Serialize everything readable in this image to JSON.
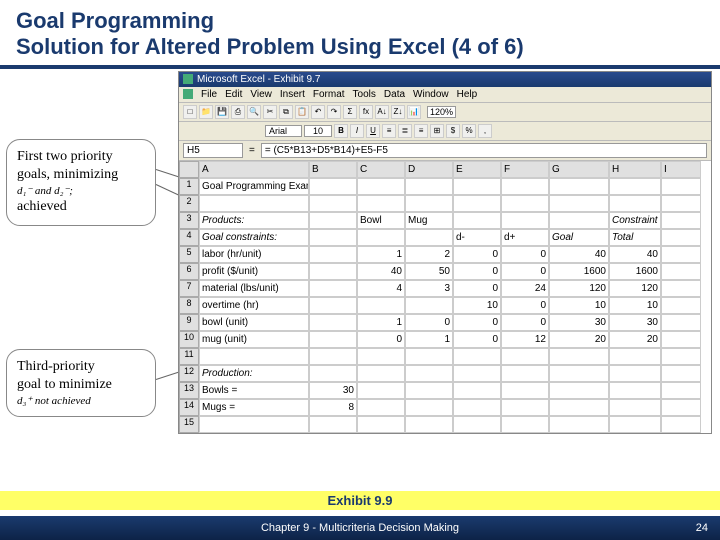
{
  "title_line1": "Goal Programming",
  "title_line2": "Solution for Altered Problem Using Excel (4 of 6)",
  "callout1_l1": "First two priority",
  "callout1_l2": "goals, minimizing",
  "callout1_l3": "d₁⁻ and d₂⁻;",
  "callout1_l4": "achieved",
  "callout2_l1": "Third-priority",
  "callout2_l2": "goal to minimize",
  "callout2_l3": "d₃⁺ not achieved",
  "excel_title": "Microsoft Excel - Exhibit 9.7",
  "menu": {
    "file": "File",
    "edit": "Edit",
    "view": "View",
    "insert": "Insert",
    "format": "Format",
    "tools": "Tools",
    "data": "Data",
    "window": "Window",
    "help": "Help"
  },
  "font": "Arial",
  "fontsize": "10",
  "zoom": "120%",
  "namebox": "H5",
  "formula": "= (C5*B13+D5*B14)+E5-F5",
  "cols": [
    "A",
    "B",
    "C",
    "D",
    "E",
    "F",
    "G",
    "H",
    "I"
  ],
  "rows": {
    "1": {
      "A": "Goal Programming Example: The Beaver Creek Pottery Company"
    },
    "2": {},
    "3": {
      "A": "Products:",
      "C": "Bowl",
      "D": "Mug",
      "H": "Constraint"
    },
    "4": {
      "A": "Goal constraints:",
      "E": "d-",
      "F": "d+",
      "G": "Goal",
      "H": "Total"
    },
    "5": {
      "A": "  labor (hr/unit)",
      "C": "1",
      "D": "2",
      "E": "0",
      "F": "0",
      "G": "40",
      "H": "40"
    },
    "6": {
      "A": "  profit ($/unit)",
      "C": "40",
      "D": "50",
      "E": "0",
      "F": "0",
      "G": "1600",
      "H": "1600"
    },
    "7": {
      "A": "  material (lbs/unit)",
      "C": "4",
      "D": "3",
      "E": "0",
      "F": "24",
      "G": "120",
      "H": "120"
    },
    "8": {
      "A": "  overtime (hr)",
      "D": "",
      "E": "10",
      "F": "0",
      "G": "10",
      "H": "10"
    },
    "9": {
      "A": "  bowl (unit)",
      "C": "1",
      "D": "0",
      "E": "0",
      "F": "0",
      "G": "30",
      "H": "30"
    },
    "10": {
      "A": "  mug (unit)",
      "C": "0",
      "D": "1",
      "E": "0",
      "F": "12",
      "G": "20",
      "H": "20"
    },
    "11": {},
    "12": {
      "A": "Production:"
    },
    "13": {
      "A": "  Bowls =",
      "B": "30"
    },
    "14": {
      "A": "  Mugs =",
      "B": "8"
    },
    "15": {}
  },
  "exhibit": "Exhibit 9.9",
  "footer_text": "Chapter 9 - Multicriteria Decision Making",
  "pagenum": "24"
}
